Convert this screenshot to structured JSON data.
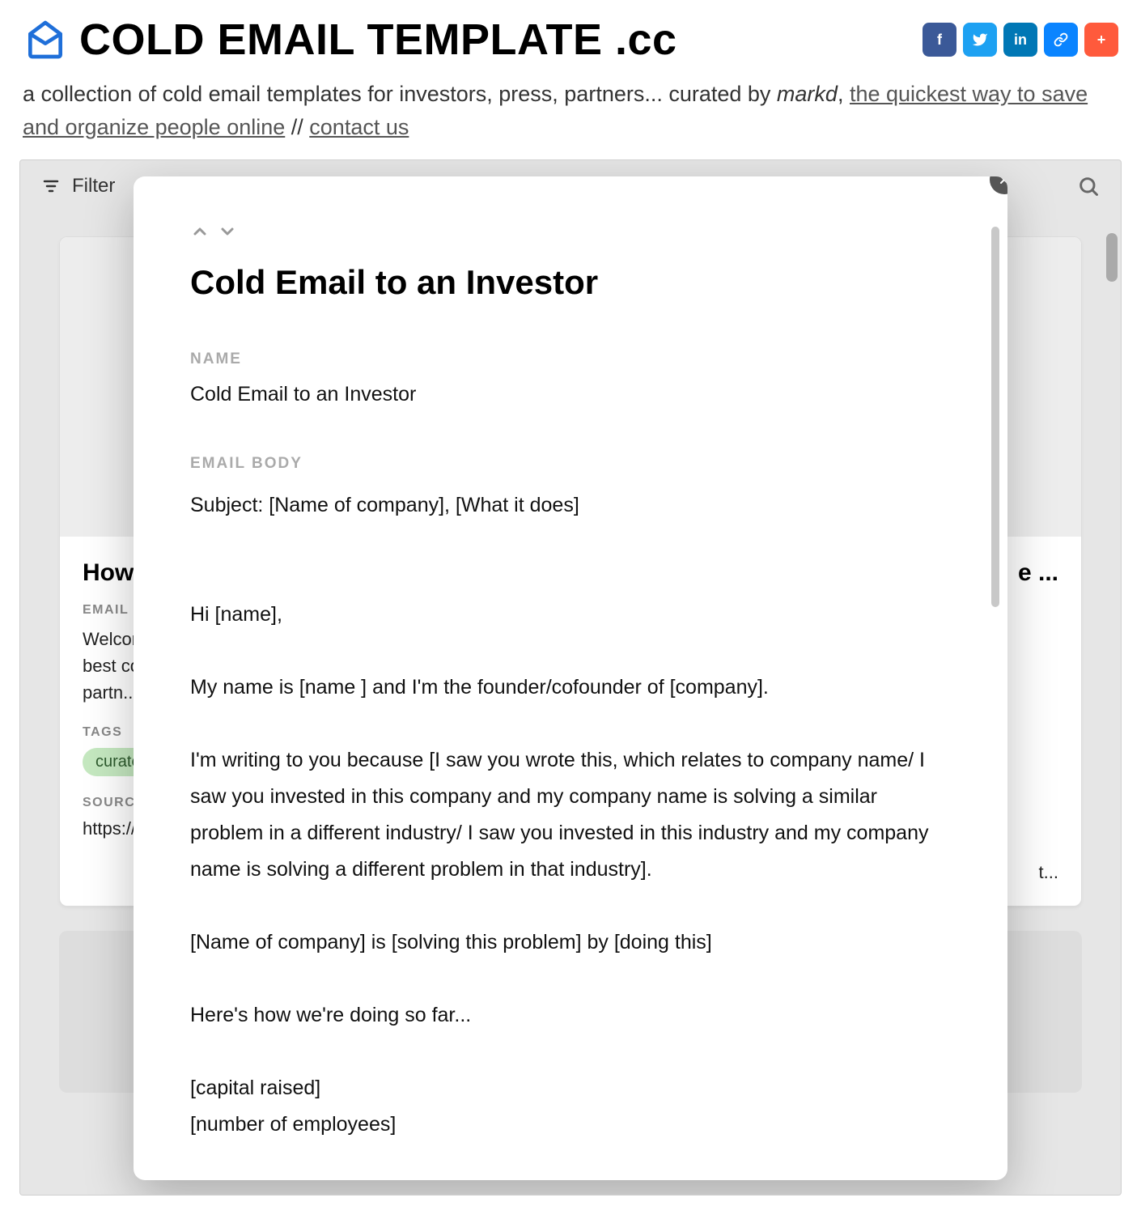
{
  "header": {
    "title_main": "COLD EMAIL TEMPLATE ",
    "title_suffix": ".cc"
  },
  "social": {
    "facebook": "f",
    "twitter": "",
    "linkedin": "in",
    "link": "",
    "plus": "+"
  },
  "subhead": {
    "pre": "a collection of cold email templates for investors, press, partners... curated by ",
    "markd": "markd",
    "comma": ", ",
    "link1": "the quickest way to save and organize people online",
    "sep": " // ",
    "link2": "contact us"
  },
  "toolbar": {
    "filter_label": "Filter"
  },
  "cards": {
    "left": {
      "title": "How To Use...",
      "label_body": "EMAIL BODY",
      "body": "Welcome to Cold Email Template - where we curate the best cold email templates for sales prospecting, for partn...",
      "label_tags": "TAGS",
      "tag": "curated by markd",
      "label_source": "SOURCE",
      "source": "https://markd.co"
    },
    "right": {
      "title_trailing": "e ...",
      "source_trailing": "t..."
    }
  },
  "modal": {
    "title": "Cold Email to an Investor",
    "name_label": "NAME",
    "name_value": "Cold Email to an Investor",
    "body_label": "EMAIL BODY",
    "body_text": "Subject: [Name of company], [What it does]\n\n\nHi [name],\n\nMy name is [name ] and I'm the founder/cofounder of [company].\n\nI'm writing to you because [I saw you wrote this, which relates to company name/ I saw you invested in this company and my company name is solving a similar problem in a different industry/ I saw you invested in this industry and my company name is solving a different problem in that industry].\n\n[Name of company] is [solving this problem] by [doing this]\n\nHere's how we're doing so far...\n\n[capital raised]\n[number of employees]"
  }
}
